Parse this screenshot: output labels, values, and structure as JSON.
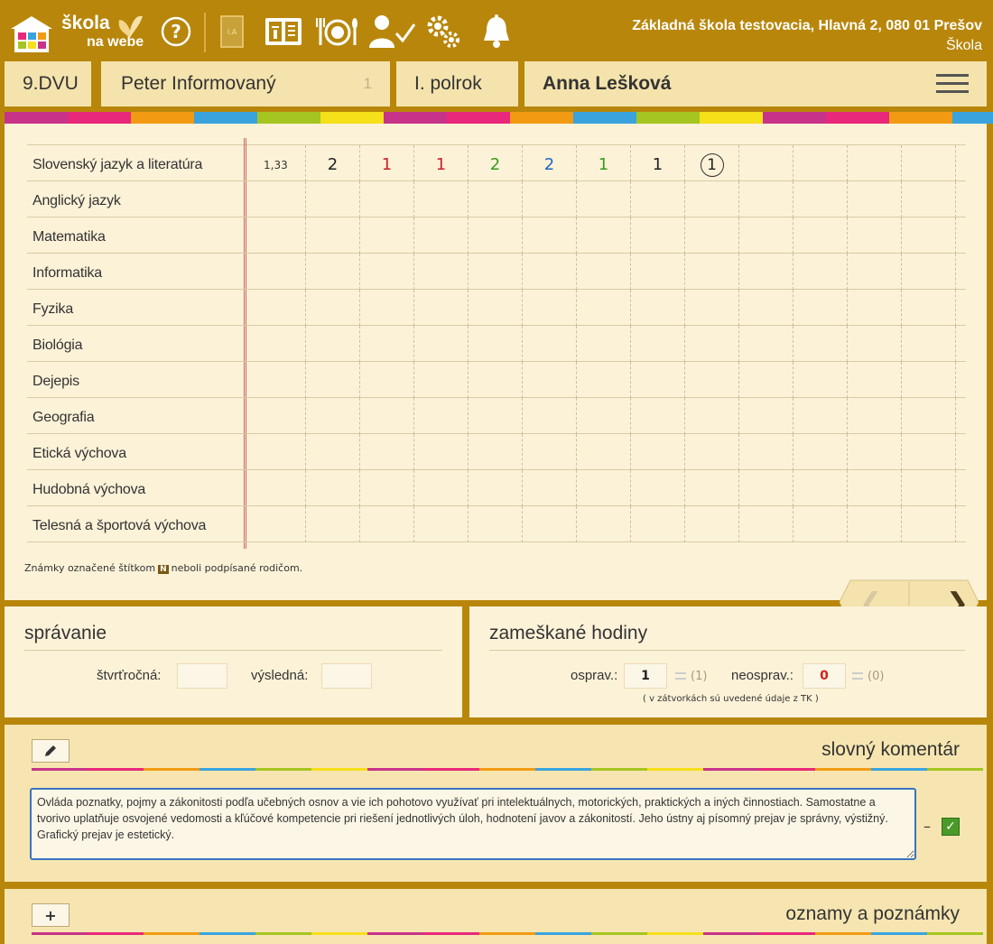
{
  "header": {
    "logo_line1": "škola",
    "logo_line2": "na webe",
    "school_name": "Základná škola testovacia, Hlavná 2, 080 01 Prešov",
    "school_role": "Škola",
    "icons": [
      "help-icon",
      "class-book-icon",
      "open-book-icon",
      "meal-icon",
      "teacher-check-icon",
      "gears-icon",
      "bell-icon"
    ]
  },
  "info": {
    "class": "9.DVU",
    "teacher": "Peter Informovaný",
    "teacher_count": "1",
    "term": "I. polrok",
    "student": "Anna Lešková"
  },
  "stripe_colors": [
    "#c8338a",
    "#e8287a",
    "#f29b12",
    "#3aa3de",
    "#a5c520",
    "#f5e01a"
  ],
  "grades": {
    "subjects": [
      {
        "name": "Slovenský jazyk a literatúra",
        "average": "1,33",
        "marks": [
          {
            "v": "2",
            "c": "#222"
          },
          {
            "v": "1",
            "c": "#c8202a"
          },
          {
            "v": "1",
            "c": "#c8202a"
          },
          {
            "v": "2",
            "c": "#3a9a1e"
          },
          {
            "v": "2",
            "c": "#2266c0"
          },
          {
            "v": "1",
            "c": "#3a9a1e"
          },
          {
            "v": "1",
            "c": "#222"
          },
          {
            "v": "1",
            "c": "#222",
            "circled": true
          }
        ]
      },
      {
        "name": "Anglický jazyk",
        "average": "",
        "marks": []
      },
      {
        "name": "Matematika",
        "average": "",
        "marks": []
      },
      {
        "name": "Informatika",
        "average": "",
        "marks": []
      },
      {
        "name": "Fyzika",
        "average": "",
        "marks": []
      },
      {
        "name": "Biológia",
        "average": "",
        "marks": []
      },
      {
        "name": "Dejepis",
        "average": "",
        "marks": []
      },
      {
        "name": "Geografia",
        "average": "",
        "marks": []
      },
      {
        "name": "Etická výchova",
        "average": "",
        "marks": []
      },
      {
        "name": "Hudobná výchova",
        "average": "",
        "marks": []
      },
      {
        "name": "Telesná a športová výchova",
        "average": "",
        "marks": []
      }
    ],
    "note_before": "Známky označené štítkom",
    "note_badge": "N",
    "note_after": "neboli podpísané rodičom."
  },
  "behavior": {
    "title": "správanie",
    "quarter_label": "štvrťročná:",
    "quarter_value": "",
    "final_label": "výsledná:",
    "final_value": ""
  },
  "absence": {
    "title": "zameškané hodiny",
    "excused_label": "osprav.:",
    "excused_value": "1",
    "excused_tk": "(1)",
    "unexcused_label": "neosprav.:",
    "unexcused_value": "0",
    "unexcused_tk": "(0)",
    "footnote": "( v zátvorkách sú uvedené údaje z TK )"
  },
  "comment": {
    "title": "slovný komentár",
    "text": "Ovláda poznatky, pojmy a zákonitosti podľa učebných osnov a vie ich pohotovo využívať pri intelektuálnych, motorických, praktických a iných činnostiach. Samostatne a tvorivo uplatňuje osvojené vedomosti a kľúčové kompetencie pri riešení jednotlivých úloh, hodnotení javov a zákonitostí. Jeho ústny aj písomný prejav je správny, výstižný. Grafický prejav je estetický.",
    "dash": "–"
  },
  "notes": {
    "title": "oznamy a poznámky",
    "add_label": "+"
  }
}
